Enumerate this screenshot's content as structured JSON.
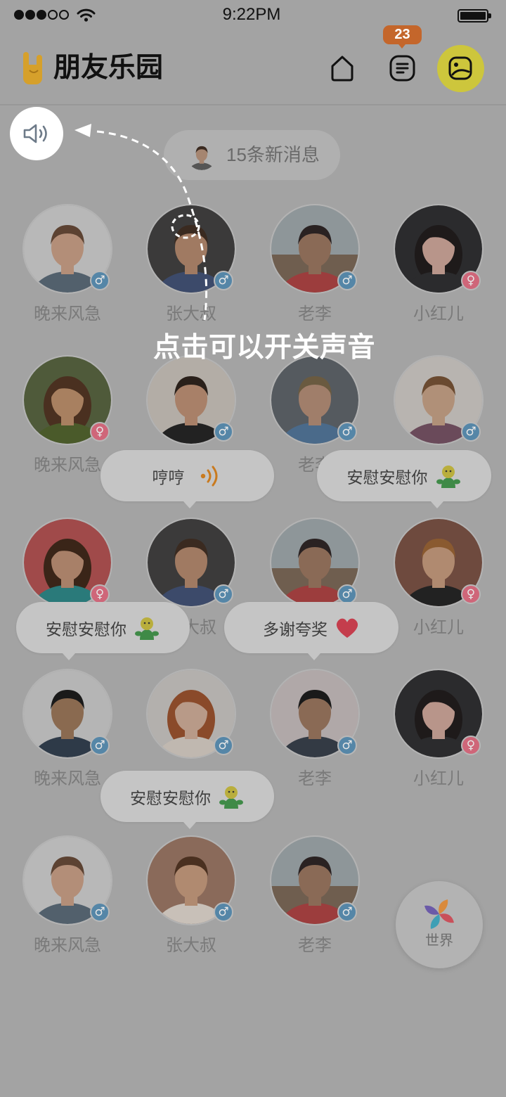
{
  "status_bar": {
    "signal_strength": 3,
    "signal_max": 5,
    "wifi_icon": "wifi-icon",
    "time": "9:22PM",
    "battery_icon": "battery-icon",
    "battery_level": 1
  },
  "header": {
    "logo_icon": "rock-hand-icon",
    "title": "朋友乐园",
    "home_icon": "home-icon",
    "messages_icon": "messages-icon",
    "messages_badge": "23",
    "profile_icon": "profile-photo-icon"
  },
  "sound_toggle": {
    "icon": "speaker-icon"
  },
  "new_messages": {
    "label": "15条新消息"
  },
  "grid": {
    "rows": [
      [
        {
          "name": "晚来风急",
          "gender": "♂"
        },
        {
          "name": "张大叔",
          "gender": "♂"
        },
        {
          "name": "老李",
          "gender": "♂"
        },
        {
          "name": "小红儿",
          "gender": "♀"
        }
      ],
      [
        {
          "name": "晚来风急",
          "gender": "♀"
        },
        {
          "gender": "♂"
        },
        {
          "name": "老李",
          "gender": "♂"
        },
        {
          "gender": "♂"
        }
      ],
      [
        {
          "gender": "♀"
        },
        {
          "name": "张大叔",
          "gender": "♂"
        },
        {
          "gender": "♂"
        },
        {
          "name": "小红儿",
          "gender": "♀"
        }
      ],
      [
        {
          "name": "晚来风急",
          "gender": "♂"
        },
        {
          "gender": "♂"
        },
        {
          "name": "老李",
          "gender": "♂"
        },
        {
          "name": "小红儿",
          "gender": "♀"
        }
      ],
      [
        {
          "name": "晚来风急",
          "gender": "♂"
        },
        {
          "name": "张大叔",
          "gender": "♂"
        },
        {
          "name": "老李",
          "gender": "♂"
        }
      ]
    ]
  },
  "bubbles": [
    {
      "text": "哼哼",
      "icon": "voice-wave-icon"
    },
    {
      "text": "安慰安慰你",
      "icon": "hug-emoji-icon"
    },
    {
      "text": "安慰安慰你",
      "icon": "hug-emoji-icon"
    },
    {
      "text": "多谢夸奖",
      "icon": "heart-icon"
    },
    {
      "text": "安慰安慰你",
      "icon": "hug-emoji-icon"
    }
  ],
  "world_button": {
    "label": "世界",
    "icon": "pinwheel-icon"
  },
  "guide": {
    "hint": "点击可以开关声音"
  },
  "colors": {
    "brand_yellow": "#cdc63c",
    "logo_yellow": "#d6a02b",
    "badge_orange": "#c4662b",
    "male_badge": "#5586a7",
    "female_badge": "#cf6679",
    "highlight": "#ffffff"
  }
}
